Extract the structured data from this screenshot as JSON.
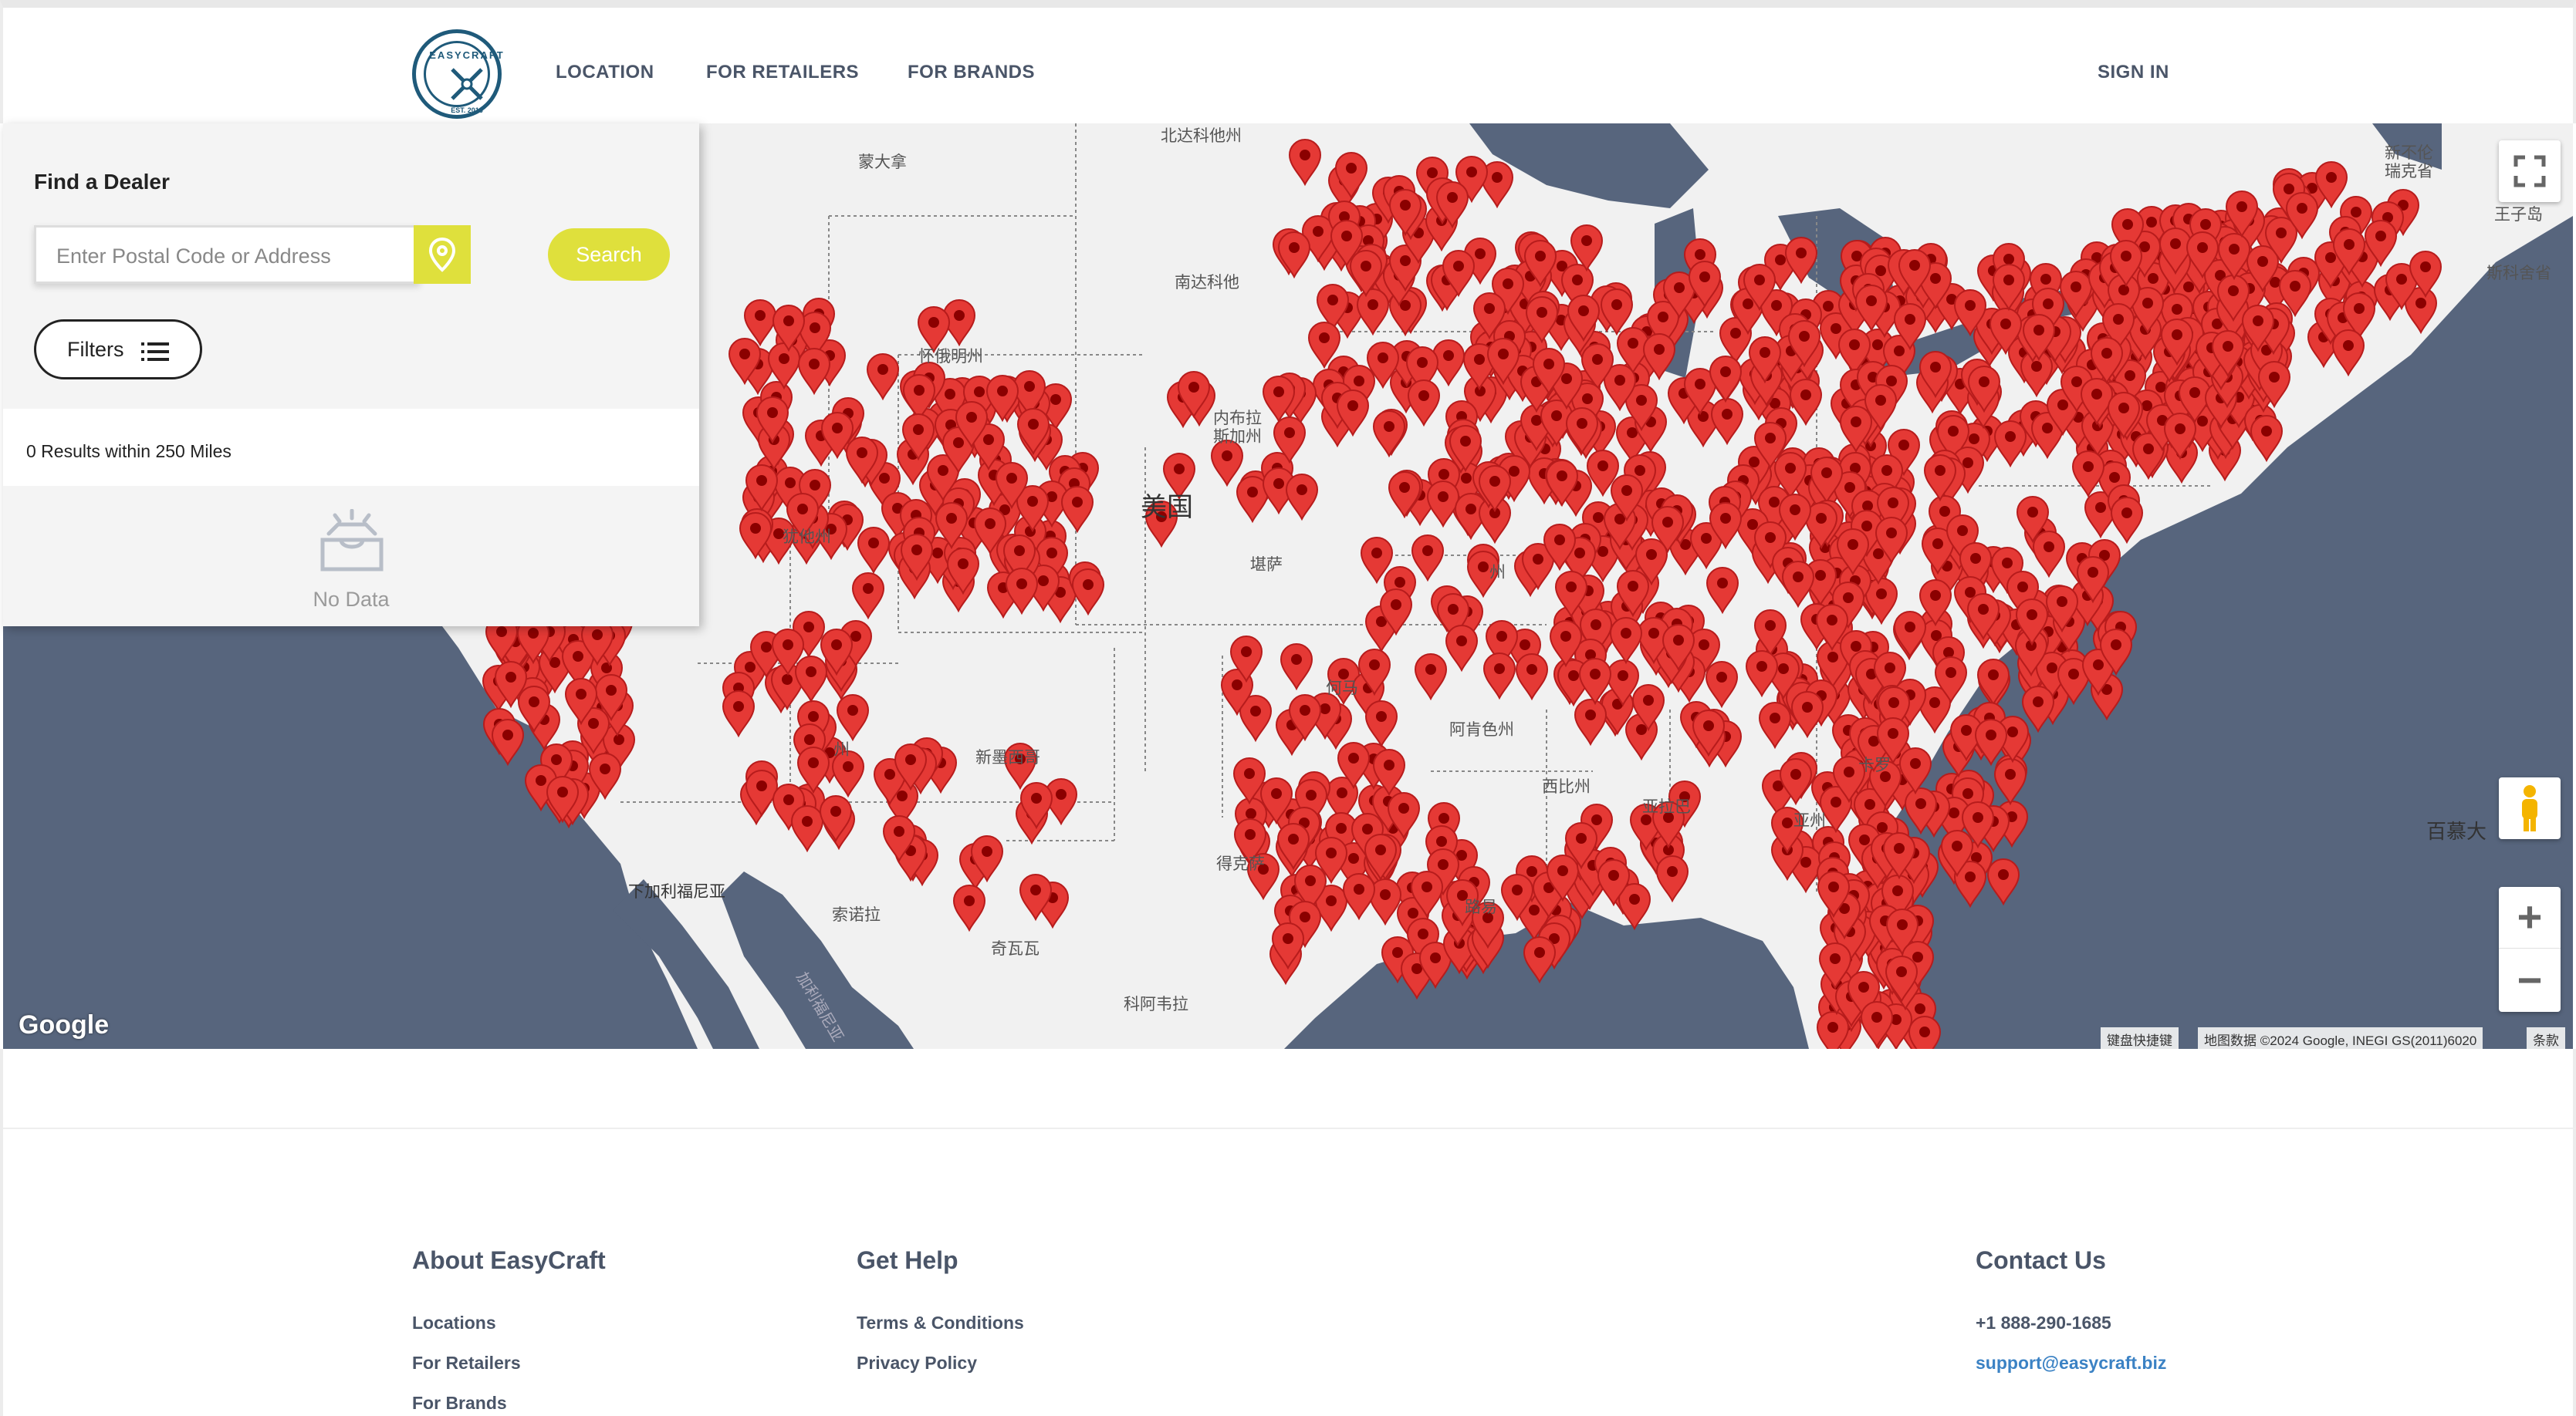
{
  "header": {
    "logo_text": "EASYCRAFT",
    "logo_est": "EST. 2016",
    "nav": [
      "LOCATION",
      "FOR RETAILERS",
      "FOR BRANDS"
    ],
    "sign_in": "SIGN IN"
  },
  "dealer_panel": {
    "title": "Find a Dealer",
    "search_placeholder": "Enter Postal Code or Address",
    "location_icon": "location-pin-icon",
    "search_label": "Search",
    "filters_label": "Filters",
    "filters_icon": "list-icon",
    "results_text": "0 Results within 250 Miles",
    "empty_icon": "inbox-icon",
    "empty_text": "No Data"
  },
  "map": {
    "labels": {
      "northdakota": "北达科他州",
      "montana": "蒙大拿",
      "southdakota": "南达科他",
      "wyoming": "怀俄明州",
      "nebraska": "内布拉\n斯加州",
      "usa": "美国",
      "utah": "犹他州",
      "kansas": "堪萨",
      "oklahoma": "何马",
      "newmexico": "新墨西哥",
      "arkansas": "阿肯色州",
      "texas": "得克萨",
      "louisiana": "路易",
      "bajacalifornia": "下加利福尼亚",
      "sonora": "索诺拉",
      "chihuahua": "奇瓦瓦",
      "coahuila": "科阿韦拉",
      "gulf": "加利福尼亚",
      "newbrunswick": "新不伦\n瑞克省",
      "pei": "王子岛",
      "novascotia": "斯科舍省",
      "bermuda": "百慕大",
      "missouri": "州",
      "arizona": "州",
      "alabama": "亚拉巴",
      "georgia": "亚州",
      "sc": "卡罗",
      "mississippi": "西比州"
    },
    "google": "Google",
    "attrib_keys": "键盘快捷键",
    "attrib_data": "地图数据 ©2024 Google, INEGI GS(2011)6020",
    "attrib_terms": "条款",
    "fullscreen_icon": "fullscreen-icon",
    "pegman_icon": "pegman-icon",
    "zoom_in": "+",
    "zoom_out": "−"
  },
  "footer": {
    "about": {
      "title": "About EasyCraft",
      "links": [
        "Locations",
        "For Retailers",
        "For Brands"
      ]
    },
    "help": {
      "title": "Get Help",
      "links": [
        "Terms & Conditions",
        "Privacy Policy"
      ]
    },
    "contact": {
      "title": "Contact Us",
      "phone": "+1 888-290-1685",
      "email": "support@easycraft.biz"
    }
  }
}
